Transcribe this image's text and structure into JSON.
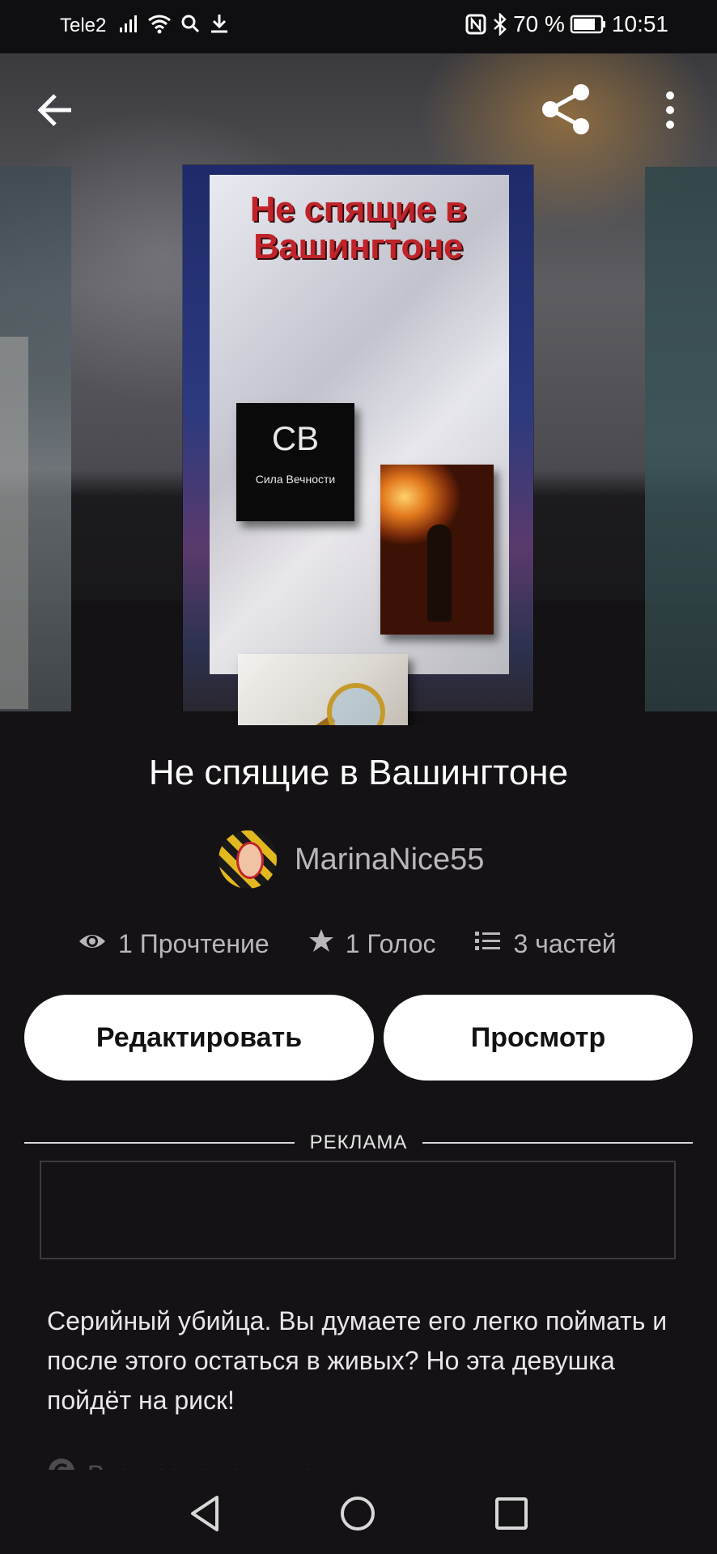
{
  "status_bar": {
    "carrier": "Tele2",
    "battery": "70 %",
    "time": "10:51",
    "icons": [
      "signal-icon",
      "wifi-icon",
      "search-icon",
      "download-icon",
      "nfc-icon",
      "bluetooth-icon",
      "battery-icon"
    ]
  },
  "toolbar": {
    "back_icon": "arrow-left-icon",
    "share_icon": "share-icon",
    "more_icon": "more-vertical-icon"
  },
  "cover": {
    "title_line1": "Не спящие в",
    "title_line2": "Вашингтоне",
    "logo_text": "СВ",
    "logo_subtext": "Сила Вечности"
  },
  "story": {
    "title": "Не спящие в Вашингтоне",
    "author": "MarinaNice55"
  },
  "stats": {
    "reads": "1 Прочтение",
    "votes": "1 Голос",
    "parts": "3 частей"
  },
  "actions": {
    "edit_label": "Редактировать",
    "view_label": "Просмотр"
  },
  "ad": {
    "label": "РЕКЛАМА"
  },
  "description": {
    "text": "Серийный убийца. Вы думаете его легко поймать и после этого остаться в живых? Но эта девушка пойдёт на риск!",
    "rights": "Все права защищены"
  },
  "nav_bar": {
    "icons": [
      "nav-back-icon",
      "nav-home-icon",
      "nav-recents-icon"
    ]
  },
  "colors": {
    "background": "#141214",
    "button_bg": "#ffffff",
    "muted_text": "#b9b7bb",
    "cover_title": "#c0242a"
  }
}
